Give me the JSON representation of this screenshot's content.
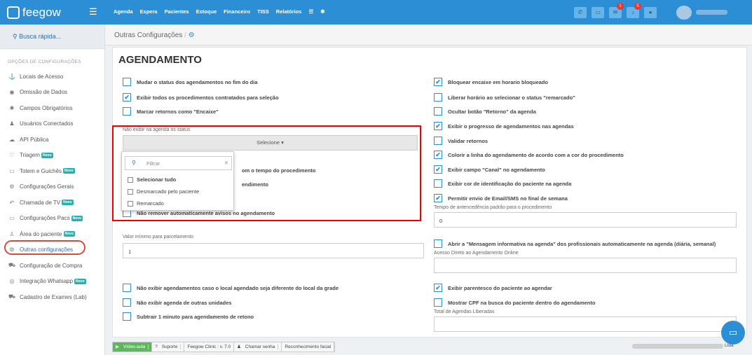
{
  "app": {
    "logo_text": "feegow"
  },
  "nav": [
    "Agenda",
    "Espera",
    "Pacientes",
    "Estoque",
    "Financeiro",
    "TISS",
    "Relatórios"
  ],
  "top_badges": {
    "messages": "1",
    "alerts": "5"
  },
  "sidebar": {
    "search": "Busca rápida...",
    "section": "OPÇÕES DE CONFIGURAÇÕES",
    "items": [
      {
        "label": "Locais de Acesso",
        "icon": "⚓",
        "new": ""
      },
      {
        "label": "Omissão de Dados",
        "icon": "◉",
        "new": ""
      },
      {
        "label": "Campos Obrigatórios",
        "icon": "✱",
        "new": ""
      },
      {
        "label": "Usuários Conectados",
        "icon": "♟",
        "new": ""
      },
      {
        "label": "API Pública",
        "icon": "☁",
        "new": ""
      },
      {
        "label": "Triagem",
        "icon": "♡",
        "new": "Novo"
      },
      {
        "label": "Totem e Guichês",
        "icon": "▭",
        "new": "Novo"
      },
      {
        "label": "Configurações Gerais",
        "icon": "⚙",
        "new": ""
      },
      {
        "label": "Chamada de TV",
        "icon": "↶",
        "new": "Novo"
      },
      {
        "label": "Configurações Pacs",
        "icon": "▭",
        "new": "Novo"
      },
      {
        "label": "Área do paciente",
        "icon": "♙",
        "new": "Novo"
      },
      {
        "label": "Outras configurações",
        "icon": "⚙",
        "new": ""
      },
      {
        "label": "Configuração de Compra",
        "icon": "⛟",
        "new": ""
      },
      {
        "label": "Integração Whatsapp",
        "icon": "◎",
        "new": "Novo"
      },
      {
        "label": "Cadastro de Exames (Lab)",
        "icon": "⛟",
        "new": ""
      }
    ]
  },
  "breadcrumb": "Outras Configurações",
  "section_title": "AGENDAMENTO",
  "left_checks": [
    {
      "label": "Mudar o status dos agendamentos no fim do dia",
      "checked": false
    },
    {
      "label": "Exibir todos os procedimentos contratados para seleção",
      "checked": true
    },
    {
      "label": "Marcar retornos como \"Encaixe\"",
      "checked": false
    }
  ],
  "status_filter": {
    "label": "Não exibir na agenda os status",
    "button": "Selecione",
    "search_placeholder": "Filtrar",
    "options": [
      "Selecionar tudo",
      "Desmarcado pelo paciente",
      "Remarcado"
    ]
  },
  "partial_texts": [
    "om o tempo do procedimento",
    "endimento"
  ],
  "left_check_after": "Não remover automaticamente avisos no agendamento",
  "min_installment": {
    "label": "Valor mínimo para parcelamento",
    "value": "1"
  },
  "left_checks_bottom": [
    "Não exibir agendamentos caso o local agendado seja diferente do local da grade",
    "Não exibir agenda de outras unidades",
    "Subtrair 1 minuto para agendamento de retono"
  ],
  "right_checks": [
    {
      "label": "Bloquear encaixe em horario bloqueado",
      "checked": true
    },
    {
      "label": "Liberar horário ao selecionar o status \"remarcado\"",
      "checked": false
    },
    {
      "label": "Ocultar botão \"Retorno\" da agenda",
      "checked": false
    },
    {
      "label": "Exibir o progresso de agendamentos nas agendas",
      "checked": true
    },
    {
      "label": "Validar retornos",
      "checked": false
    },
    {
      "label": "Colorir a linha do agendamento de acordo com a cor do procedimento",
      "checked": true
    },
    {
      "label": "Exibir campo \"Canal\" no agendamento",
      "checked": true
    },
    {
      "label": "Exibir cor de identificação do paciente na agenda",
      "checked": false
    },
    {
      "label": "Permitir envio de Email/SMS no final de semana",
      "checked": true
    }
  ],
  "antecedence": {
    "label": "Tempo de antencedência padrão para o procedimento",
    "value": "0"
  },
  "info_message": "Abrir a \"Mensagem informativa na agenda\" dos profissionais automaticamente na agenda (diária, semanal)",
  "online_access_label": "Acesso Direto ao Agendamento Online",
  "right_checks_bottom": [
    {
      "label": "Exibir parentesco do paciente ao agendar",
      "checked": true
    },
    {
      "label": "Mostrar CPF na busca do paciente dentro do agendamento",
      "checked": false
    }
  ],
  "released_label": "Total de Agendas Liberadas",
  "footer": {
    "video": "Vídeo-aula",
    "support": "Suporte",
    "version": "Feegow Clinic : v. 7.0",
    "password": "Chamar senha",
    "facial": "Reconhecimento facial",
    "company_suffix": "Ltda"
  }
}
